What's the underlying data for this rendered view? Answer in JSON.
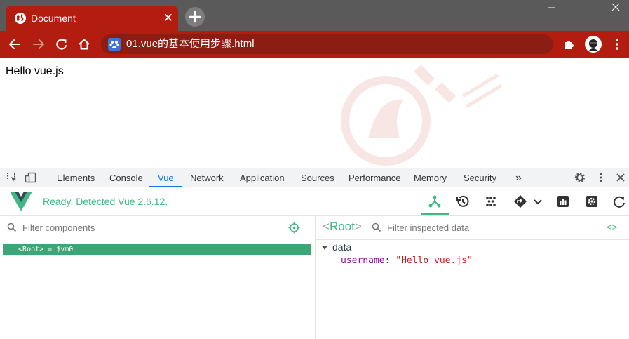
{
  "browser": {
    "tab_title": "Document",
    "tab_close": "✕",
    "url": "01.vue的基本使用步骤.html"
  },
  "page": {
    "text": "Hello vue.js"
  },
  "devtools": {
    "tabs": [
      "Elements",
      "Console",
      "Vue",
      "Network",
      "Application",
      "Sources",
      "Performance",
      "Memory",
      "Security"
    ],
    "active_tab": "Vue",
    "more_tabs": "»"
  },
  "vue": {
    "status": "Ready. Detected Vue 2.6.12.",
    "filter_components_placeholder": "Filter components",
    "component_tree": {
      "root_open": "<",
      "root_name": "Root",
      "root_close": ">",
      "root_suffix": " = $vm0"
    },
    "inspector": {
      "selected_open": "<",
      "selected_name": "Root",
      "selected_close": ">",
      "filter_placeholder": "Filter inspected data",
      "code_toggle": "<>",
      "section_title": "data",
      "field_key": "username",
      "field_sep": ": ",
      "field_value": "\"Hello vue.js\""
    }
  },
  "colors": {
    "browser_red": "#b21d0f",
    "vue_green": "#42b883",
    "active_row": "#3ba776",
    "string_red": "#c41a16",
    "key_purple": "#881391"
  }
}
